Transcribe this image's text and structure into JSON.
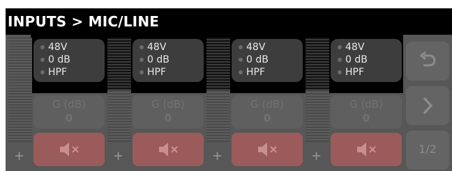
{
  "header": {
    "title": "INPUTS > MIC/LINE"
  },
  "channels": [
    {
      "phantom": "48V",
      "gain_readout": "0 dB",
      "filter": "HPF",
      "gain_label": "G (dB)",
      "gain_value": "0"
    },
    {
      "phantom": "48V",
      "gain_readout": "0 dB",
      "filter": "HPF",
      "gain_label": "G (dB)",
      "gain_value": "0"
    },
    {
      "phantom": "48V",
      "gain_readout": "0 dB",
      "filter": "HPF",
      "gain_label": "G (dB)",
      "gain_value": "0"
    },
    {
      "phantom": "48V",
      "gain_readout": "0 dB",
      "filter": "HPF",
      "gain_label": "G (dB)",
      "gain_value": "0"
    }
  ],
  "add_label": "+",
  "icons": {
    "mute": "speaker-muted-icon",
    "undo": "undo-icon",
    "next": "chevron-right-icon"
  },
  "sidebar": {
    "page_indicator": "1/2"
  },
  "colors": {
    "background": "#575757",
    "header": "#000000",
    "mute_button": "#9c5b5b",
    "chip": "#3d3d3d"
  }
}
